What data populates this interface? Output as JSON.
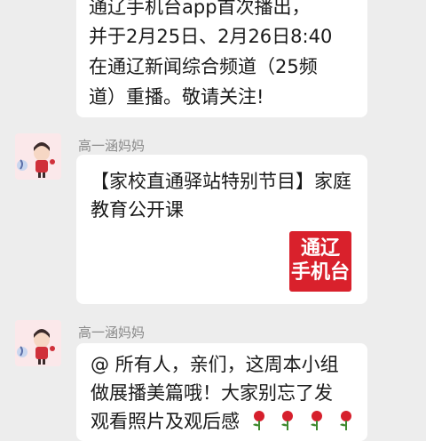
{
  "messages": [
    {
      "lines": [
        "通辽手机台app首次播出，",
        "并于2月25日、2月26日8:40",
        "在通辽新闻综合频道（25频",
        "道）重播。敬请关注!"
      ]
    },
    {
      "sender": "高一涵妈妈",
      "text": "【家校直通驿站特别节目】家庭教育公开课",
      "logo_lines": [
        "通辽",
        "手机台"
      ],
      "logo_color": "#d9212c"
    },
    {
      "sender": "高一涵妈妈",
      "lines": [
        "@ 所有人，亲们，这周本小组",
        "做展播美篇哦！大家别忘了发",
        "观看照片及观后感"
      ],
      "emoji": "rose-icon"
    }
  ]
}
